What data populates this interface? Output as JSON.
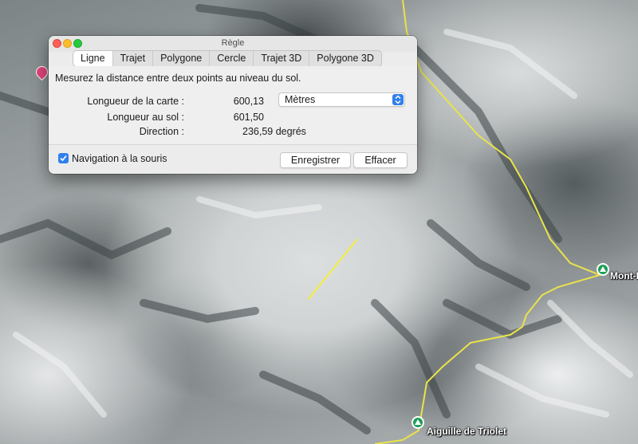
{
  "window": {
    "title": "Règle",
    "tabs": [
      "Ligne",
      "Trajet",
      "Polygone",
      "Cercle",
      "Trajet 3D",
      "Polygone 3D"
    ],
    "active_tab": "Ligne",
    "description": "Mesurez la distance entre deux points au niveau du sol.",
    "map_length": {
      "label": "Longueur de la carte :",
      "value": "600,13"
    },
    "unit_select": {
      "selected": "Mètres"
    },
    "ground_length": {
      "label": "Longueur au sol :",
      "value": "601,50"
    },
    "direction": {
      "label": "Direction :",
      "value": "236,59 degrés"
    },
    "mouse_navigation": {
      "label": "Navigation à la souris",
      "checked": true
    },
    "buttons": {
      "save": "Enregistrer",
      "clear": "Effacer"
    }
  },
  "map": {
    "places": [
      {
        "name": "Mont-D",
        "icon": "mountain-peak-icon"
      },
      {
        "name": "Aiguille de Triolet",
        "icon": "mountain-peak-icon"
      }
    ],
    "colors": {
      "border_line": "#e9e34a",
      "ruler_line": "#f4ef3c",
      "peak_marker": "#1f9d57",
      "pin": "#e0457b"
    }
  }
}
